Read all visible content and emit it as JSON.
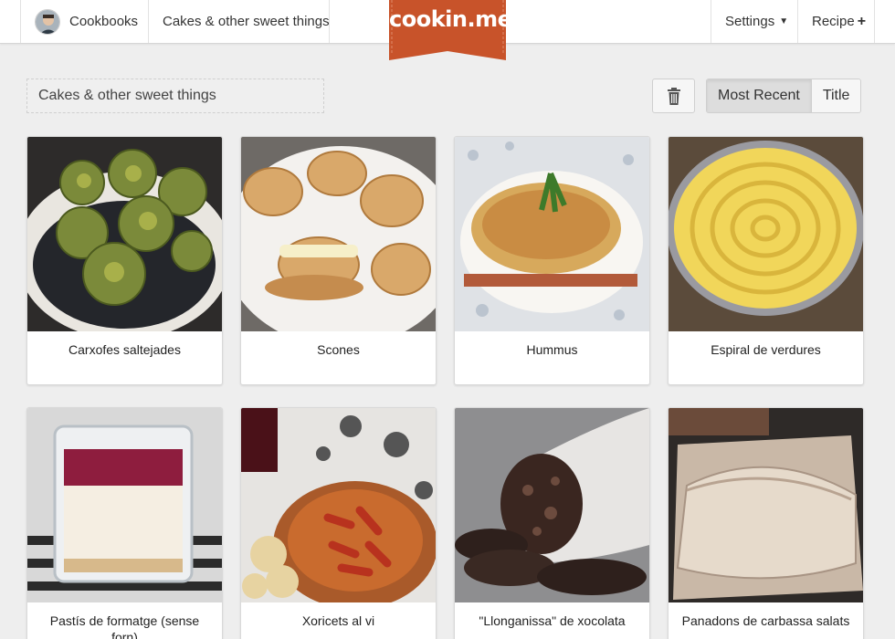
{
  "nav": {
    "cookbooks_label": "Cookbooks",
    "current_cookbook": "Cakes & other sweet things",
    "logo_text": "cookin.me",
    "settings_label": "Settings",
    "recipe_label": "Recipe"
  },
  "toolbar": {
    "cookbook_title": "Cakes & other sweet things",
    "sort_options": [
      "Most Recent",
      "Title"
    ],
    "active_sort": "Most Recent"
  },
  "recipes": [
    {
      "title": "Carxofes saltejades"
    },
    {
      "title": "Scones"
    },
    {
      "title": "Hummus"
    },
    {
      "title": "Espiral de verdures"
    },
    {
      "title": "Pastís de formatge (sense forn)"
    },
    {
      "title": "Xoricets al vi"
    },
    {
      "title": "\"Llonganissa\" de xocolata"
    },
    {
      "title": "Panadons de carbassa salats"
    }
  ],
  "colors": {
    "brand": "#c8532a",
    "background": "#eeeeee"
  },
  "icons": [
    "avatar",
    "chevron-down-icon",
    "plus-icon",
    "trash-icon"
  ]
}
